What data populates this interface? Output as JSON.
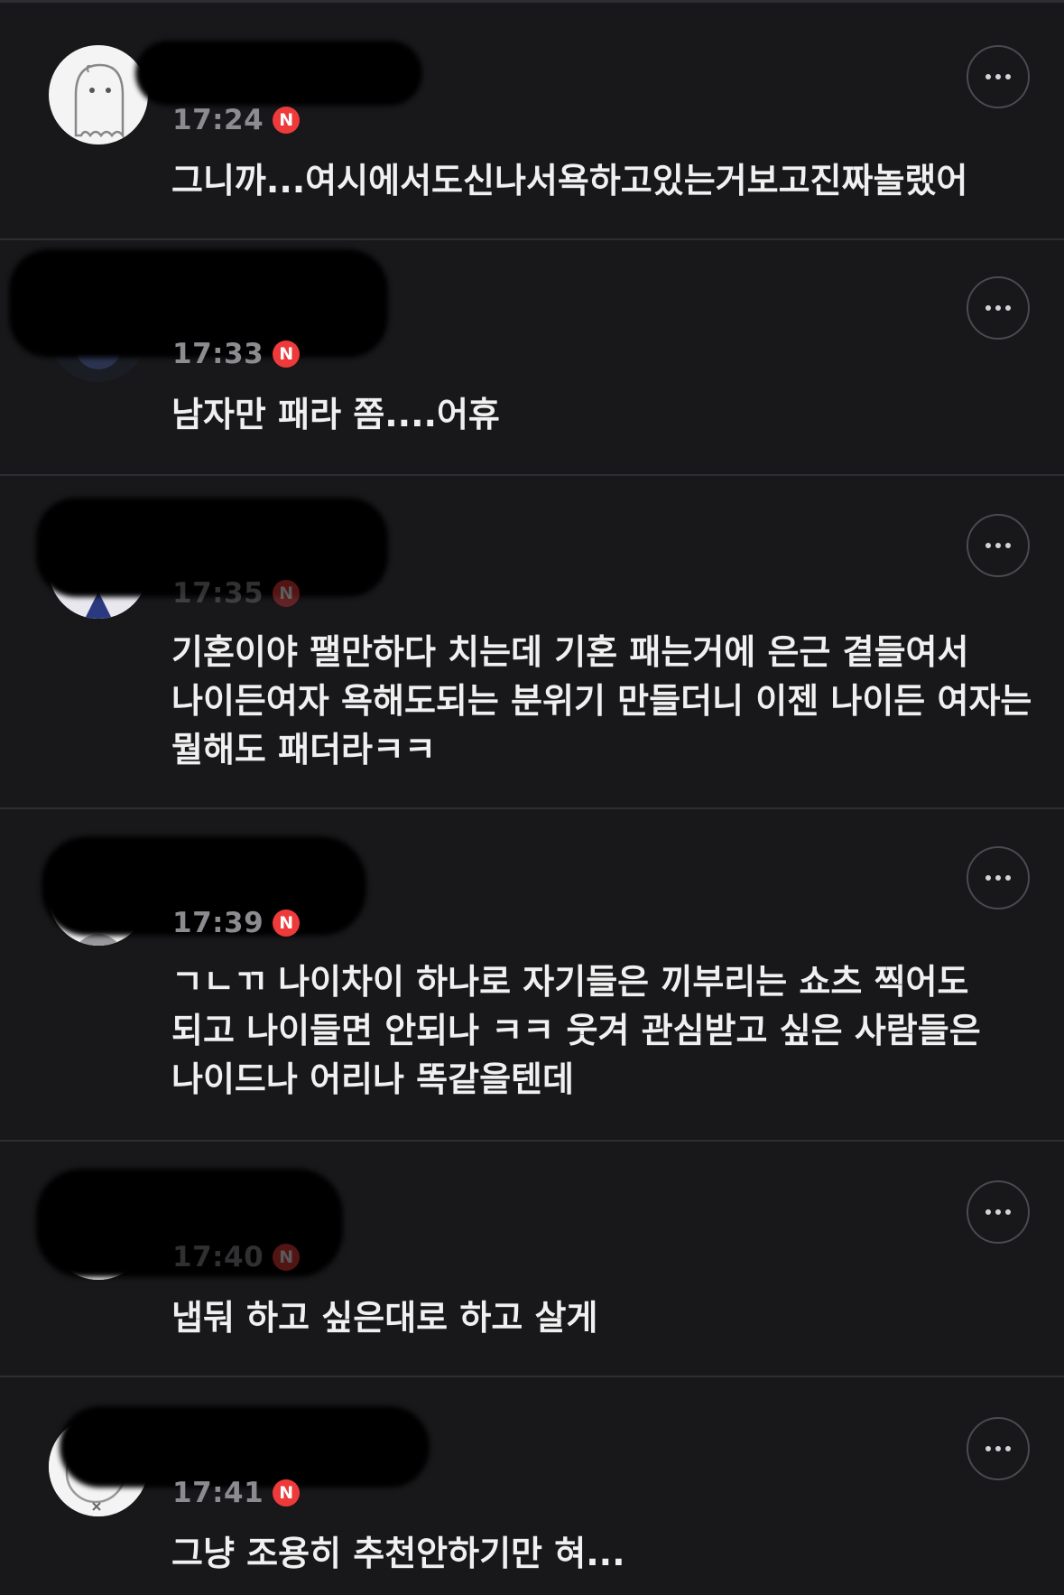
{
  "colors": {
    "background": "#18181b",
    "divider": "#2e2e32",
    "time_text": "#8b8b90",
    "new_badge": "#ee3a3a",
    "body_text": "#f0f0f0"
  },
  "comments": [
    {
      "time": "17:24",
      "badge": "N",
      "text": "그니까...여시에서도신나서욕하고있는거보고진짜놀랬어",
      "avatar_icon": "ghost-character-icon",
      "more_icon": "more-horizontal-icon"
    },
    {
      "time": "17:33",
      "badge": "N",
      "text": "남자만 패라 쫌....어휴",
      "avatar_icon": "profile-photo-icon",
      "more_icon": "more-horizontal-icon"
    },
    {
      "time": "17:35",
      "badge": "N",
      "text": "기혼이야 팰만하다 치는데 기혼 패는거에 은근 곁들여서 나이든여자 욕해도되는 분위기 만들더니 이젠 나이든 여자는 뭘해도 패더라ㅋㅋ",
      "avatar_icon": "profile-photo-icon",
      "more_icon": "more-horizontal-icon"
    },
    {
      "time": "17:39",
      "badge": "N",
      "text": "ㄱㄴㄲ 나이차이 하나로 자기들은 끼부리는 쇼츠 찍어도 되고 나이들면 안되나 ㅋㅋ 웃겨 관심받고 싶은 사람들은 나이드나 어리나 똑같을텐데",
      "avatar_icon": "character-avatar-icon",
      "more_icon": "more-horizontal-icon"
    },
    {
      "time": "17:40",
      "badge": "N",
      "text": "냅둬 하고 싶은대로 하고 살게",
      "avatar_icon": "character-avatar-icon",
      "more_icon": "more-horizontal-icon"
    },
    {
      "time": "17:41",
      "badge": "N",
      "text": "그냥 조용히 추천안하기만 혀...",
      "avatar_icon": "character-avatar-icon",
      "more_icon": "more-horizontal-icon"
    }
  ]
}
